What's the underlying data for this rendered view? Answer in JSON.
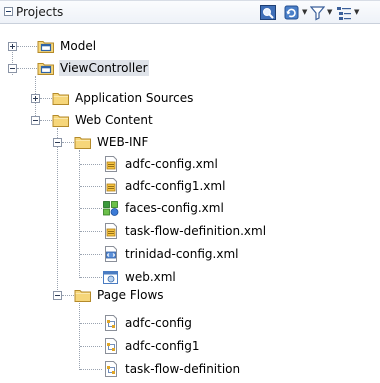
{
  "panel": {
    "title": "Projects"
  },
  "toolbar": {
    "sync_icon": "locate-icon",
    "refresh_icon": "refresh-icon",
    "filter_icon": "filter-icon",
    "options_icon": "tree-options-icon"
  },
  "tree": {
    "model": "Model",
    "view_controller": "ViewController",
    "application_sources": "Application Sources",
    "web_content": "Web Content",
    "web_inf": "WEB-INF",
    "files": [
      "adfc-config.xml",
      "adfc-config1.xml",
      "faces-config.xml",
      "task-flow-definition.xml",
      "trinidad-config.xml",
      "web.xml"
    ],
    "page_flows": "Page Flows",
    "flows": [
      "adfc-config",
      "adfc-config1",
      "task-flow-definition"
    ]
  },
  "colors": {
    "selection": "#dfe3e9",
    "folder": "#f2c94c",
    "project": "#4a90d9"
  }
}
